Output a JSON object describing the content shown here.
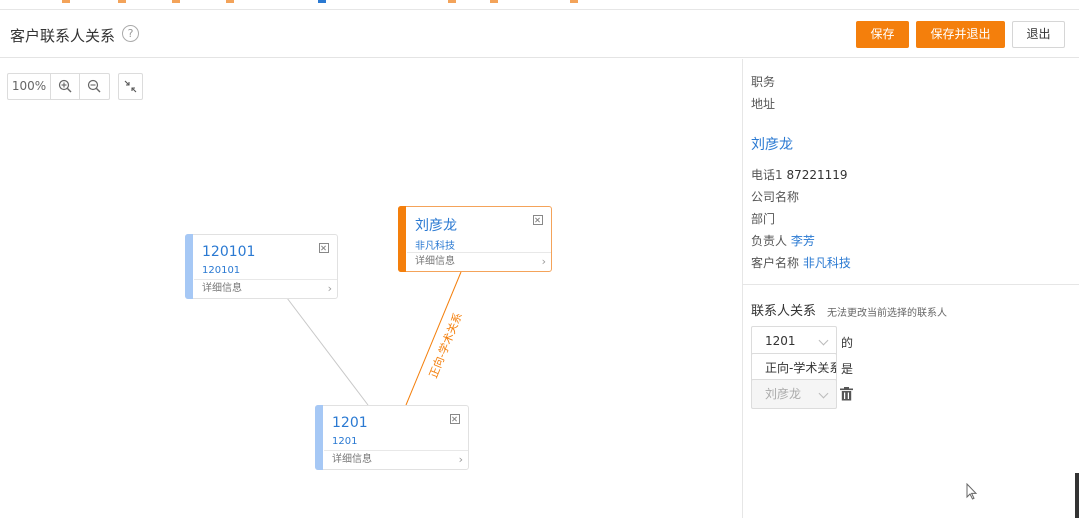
{
  "header": {
    "title": "客户联系人关系",
    "help_icon": "?",
    "save_label": "保存",
    "save_exit_label": "保存并退出",
    "exit_label": "退出"
  },
  "toolbar": {
    "zoom": "100%",
    "icons": [
      "zoom-in-icon",
      "zoom-out-icon",
      "fit-to-screen-icon"
    ]
  },
  "graph": {
    "nodes": [
      {
        "id": "n1",
        "name": "120101",
        "subtitle": "120101",
        "detail": "详细信息",
        "accent": "#a6c8f5"
      },
      {
        "id": "n2",
        "name": "刘彦龙",
        "subtitle": "非凡科技",
        "detail": "详细信息",
        "accent": "#f47f0c"
      },
      {
        "id": "n3",
        "name": "1201",
        "subtitle": "1201",
        "detail": "详细信息",
        "accent": "#a6c8f5"
      }
    ],
    "edges": [
      {
        "from": "n1",
        "to": "n3",
        "label": "",
        "color": "#c8c8c8"
      },
      {
        "from": "n2",
        "to": "n3",
        "label": "正向-学术关系",
        "color": "#f47f0c"
      }
    ]
  },
  "panel": {
    "position_label": "职务",
    "address_label": "地址",
    "contact_name": "刘彦龙",
    "phone_label": "电话1",
    "phone_value": "87221119",
    "company_label": "公司名称",
    "dept_label": "部门",
    "owner_label": "负责人",
    "owner_value": "李芳",
    "customer_label": "客户名称",
    "customer_value": "非凡科技",
    "relation_title": "联系人关系",
    "relation_note": "无法更改当前选择的联系人",
    "select_contact": "1201",
    "select_relation": "正向-学术关系",
    "select_target": "刘彦龙",
    "word_of": "的",
    "word_is": "是"
  },
  "colors": {
    "accent": "#f47f0c",
    "link": "#2a79d2"
  }
}
